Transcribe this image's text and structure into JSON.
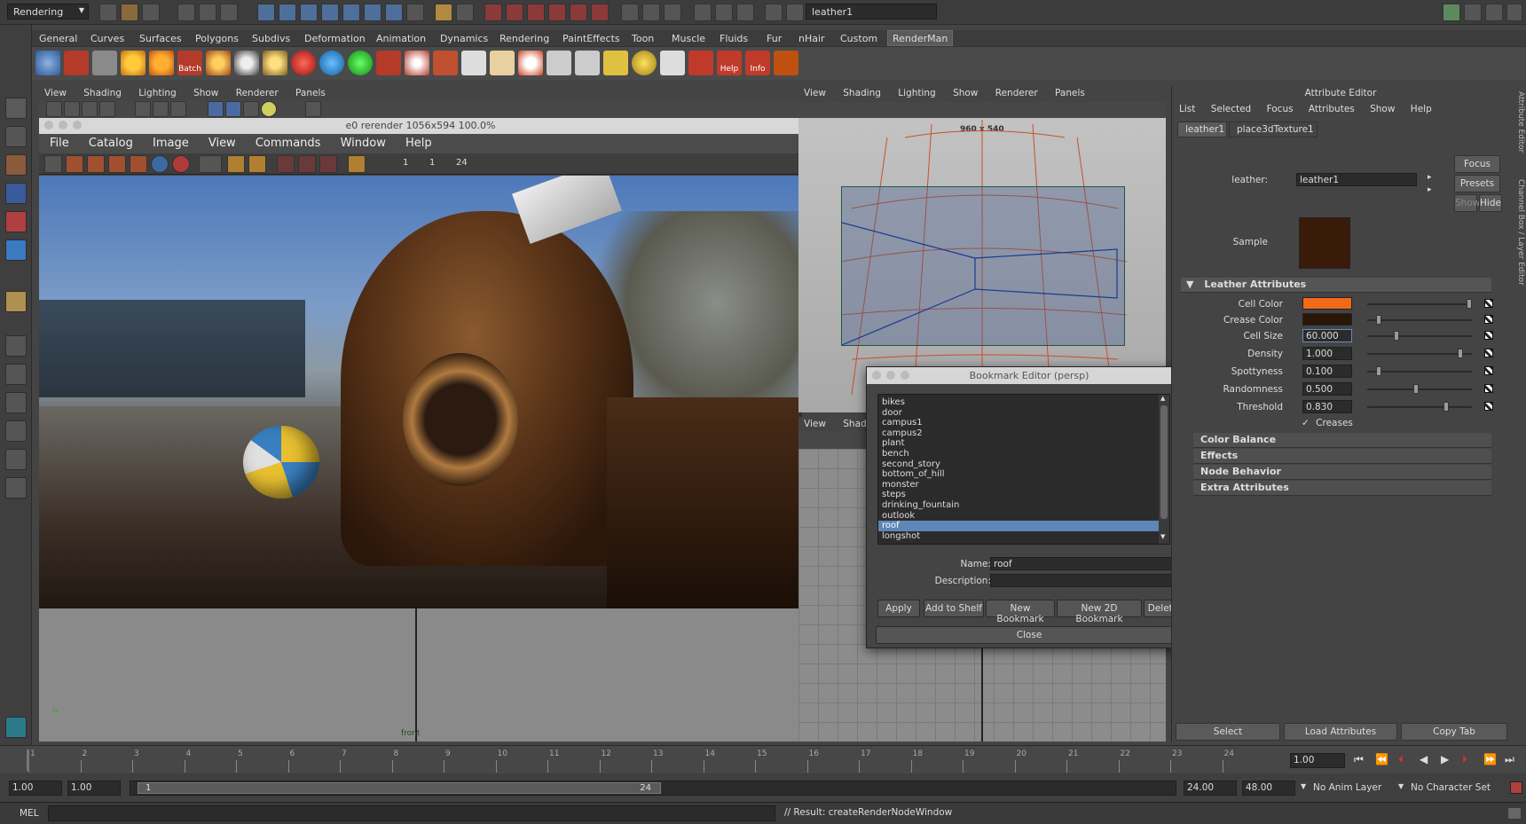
{
  "status_line": {
    "menu_set": "Rendering",
    "selection_field": "leather1"
  },
  "shelf": {
    "tabs": [
      "General",
      "Curves",
      "Surfaces",
      "Polygons",
      "Subdivs",
      "Deformation",
      "Animation",
      "Dynamics",
      "Rendering",
      "PaintEffects",
      "Toon",
      "Muscle",
      "Fluids",
      "Fur",
      "nHair",
      "Custom",
      "RenderMan"
    ],
    "active_tab": "RenderMan",
    "icon_batch_label": "Batch",
    "icon_help_label": "Help",
    "icon_info_label": "Info"
  },
  "panel_menu": [
    "View",
    "Shading",
    "Lighting",
    "Show",
    "Renderer",
    "Panels"
  ],
  "render_view": {
    "title": "e0 rerender 1056x594 100.0%",
    "menu": [
      "File",
      "Catalog",
      "Image",
      "View",
      "Commands",
      "Window",
      "Help"
    ],
    "frame_fields": [
      "1",
      "1",
      "24"
    ]
  },
  "persp": {
    "resolution_label": "960 x 540",
    "lower_label": "front"
  },
  "lower_menu": [
    "View",
    "Shadin"
  ],
  "attribute_editor": {
    "title": "Attribute Editor",
    "menu": [
      "List",
      "Selected",
      "Focus",
      "Attributes",
      "Show",
      "Help"
    ],
    "tabs": [
      "leather1",
      "place3dTexture1"
    ],
    "node_label": "leather:",
    "node_value": "leather1",
    "buttons": {
      "focus": "Focus",
      "presets": "Presets",
      "show": "Show",
      "hide": "Hide"
    },
    "sample_label": "Sample",
    "sample_color": "#3a1a08",
    "section_open": "Leather Attributes",
    "attributes": [
      {
        "label": "Cell Color",
        "type": "color",
        "color": "#f06a1a"
      },
      {
        "label": "Crease Color",
        "type": "color",
        "color": "#2a1608"
      },
      {
        "label": "Cell Size",
        "type": "value",
        "value": "60.000"
      },
      {
        "label": "Density",
        "type": "value",
        "value": "1.000"
      },
      {
        "label": "Spottyness",
        "type": "value",
        "value": "0.100"
      },
      {
        "label": "Randomness",
        "type": "value",
        "value": "0.500"
      },
      {
        "label": "Threshold",
        "type": "value",
        "value": "0.830"
      }
    ],
    "creases_label": "Creases",
    "collapsed_sections": [
      "Color Balance",
      "Effects",
      "Node Behavior",
      "Extra Attributes"
    ],
    "bottom_buttons": [
      "Select",
      "Load Attributes",
      "Copy Tab"
    ],
    "side_tab_1": "Attribute Editor",
    "side_tab_2": "Channel Box / Layer Editor"
  },
  "bookmark_editor": {
    "title": "Bookmark Editor (persp)",
    "items": [
      "bikes",
      "door",
      "campus1",
      "campus2",
      "plant",
      "bench",
      "second_story",
      "bottom_of_hill",
      "monster",
      "steps",
      "drinking_fountain",
      "outlook",
      "roof",
      "longshot"
    ],
    "selected": "roof",
    "name_label": "Name:",
    "name_value": "roof",
    "description_label": "Description:",
    "description_value": "",
    "buttons": [
      "Apply",
      "Add to Shelf",
      "New Bookmark",
      "New 2D Bookmark",
      "Delete"
    ],
    "close": "Close"
  },
  "time_slider": {
    "ticks": [
      "1",
      "2",
      "3",
      "4",
      "5",
      "6",
      "7",
      "8",
      "9",
      "10",
      "11",
      "12",
      "13",
      "14",
      "15",
      "16",
      "17",
      "18",
      "19",
      "20",
      "21",
      "22",
      "23",
      "24"
    ],
    "current_time": "1.00"
  },
  "range_slider": {
    "start": "1.00",
    "inner_start": "1.00",
    "range_left": "1",
    "range_right": "24",
    "end_inner": "24.00",
    "end": "48.00",
    "anim_layer": "No Anim Layer",
    "character_set": "No Character Set"
  },
  "command_line": {
    "label": "MEL",
    "result": "// Result: createRenderNodeWindow"
  }
}
